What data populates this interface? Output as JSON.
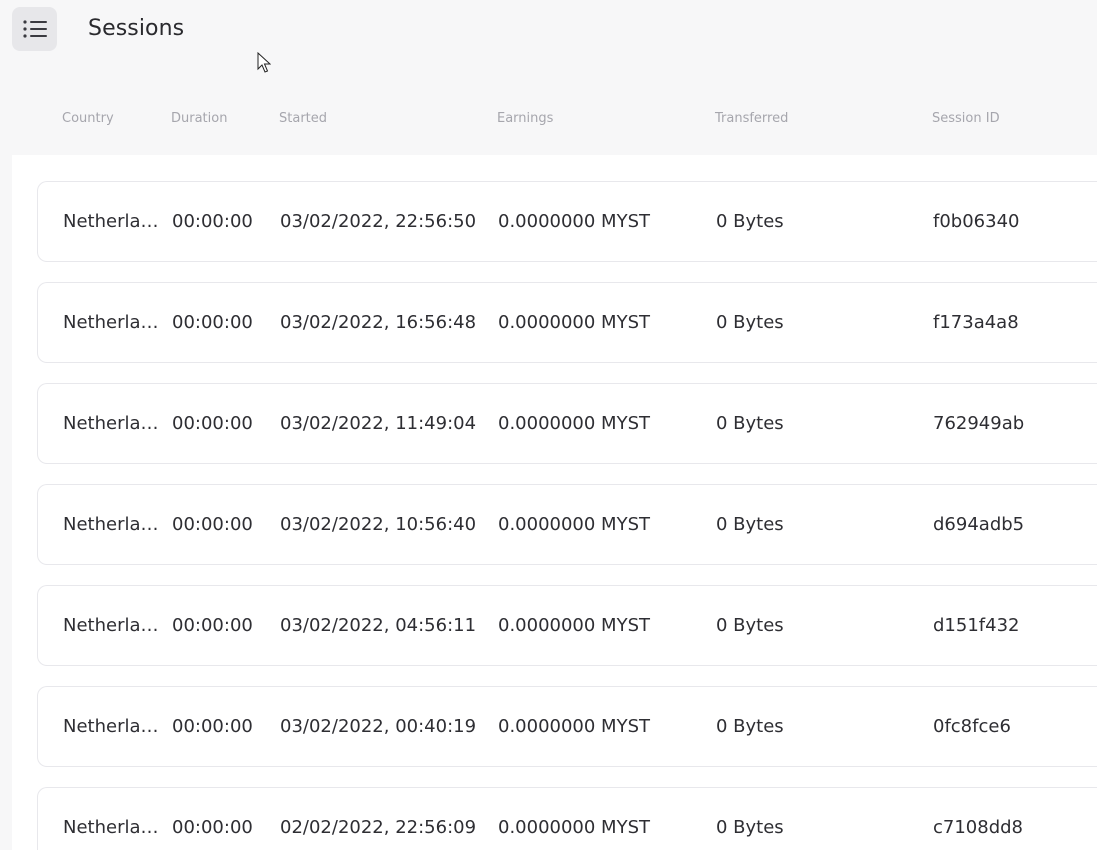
{
  "header": {
    "title": "Sessions",
    "menu_icon": "list-icon"
  },
  "table": {
    "columns": [
      "Country",
      "Duration",
      "Started",
      "Earnings",
      "Transferred",
      "Session ID"
    ],
    "rows": [
      {
        "country": "Netherlands",
        "duration": "00:00:00",
        "started": "03/02/2022, 22:56:50",
        "earnings": "0.0000000 MYST",
        "transferred": "0 Bytes",
        "session_id": "f0b06340"
      },
      {
        "country": "Netherlands",
        "duration": "00:00:00",
        "started": "03/02/2022, 16:56:48",
        "earnings": "0.0000000 MYST",
        "transferred": "0 Bytes",
        "session_id": "f173a4a8"
      },
      {
        "country": "Netherlands",
        "duration": "00:00:00",
        "started": "03/02/2022, 11:49:04",
        "earnings": "0.0000000 MYST",
        "transferred": "0 Bytes",
        "session_id": "762949ab"
      },
      {
        "country": "Netherlands",
        "duration": "00:00:00",
        "started": "03/02/2022, 10:56:40",
        "earnings": "0.0000000 MYST",
        "transferred": "0 Bytes",
        "session_id": "d694adb5"
      },
      {
        "country": "Netherlands",
        "duration": "00:00:00",
        "started": "03/02/2022, 04:56:11",
        "earnings": "0.0000000 MYST",
        "transferred": "0 Bytes",
        "session_id": "d151f432"
      },
      {
        "country": "Netherlands",
        "duration": "00:00:00",
        "started": "03/02/2022, 00:40:19",
        "earnings": "0.0000000 MYST",
        "transferred": "0 Bytes",
        "session_id": "0fc8fce6"
      },
      {
        "country": "Netherlands",
        "duration": "00:00:00",
        "started": "02/02/2022, 22:56:09",
        "earnings": "0.0000000 MYST",
        "transferred": "0 Bytes",
        "session_id": "c7108dd8"
      }
    ]
  },
  "colors": {
    "background": "#f7f7f8",
    "panel": "#ffffff",
    "header_text": "#a6a6ad",
    "row_text": "#2e2e33",
    "menu_button_bg": "#e7e7ea"
  }
}
